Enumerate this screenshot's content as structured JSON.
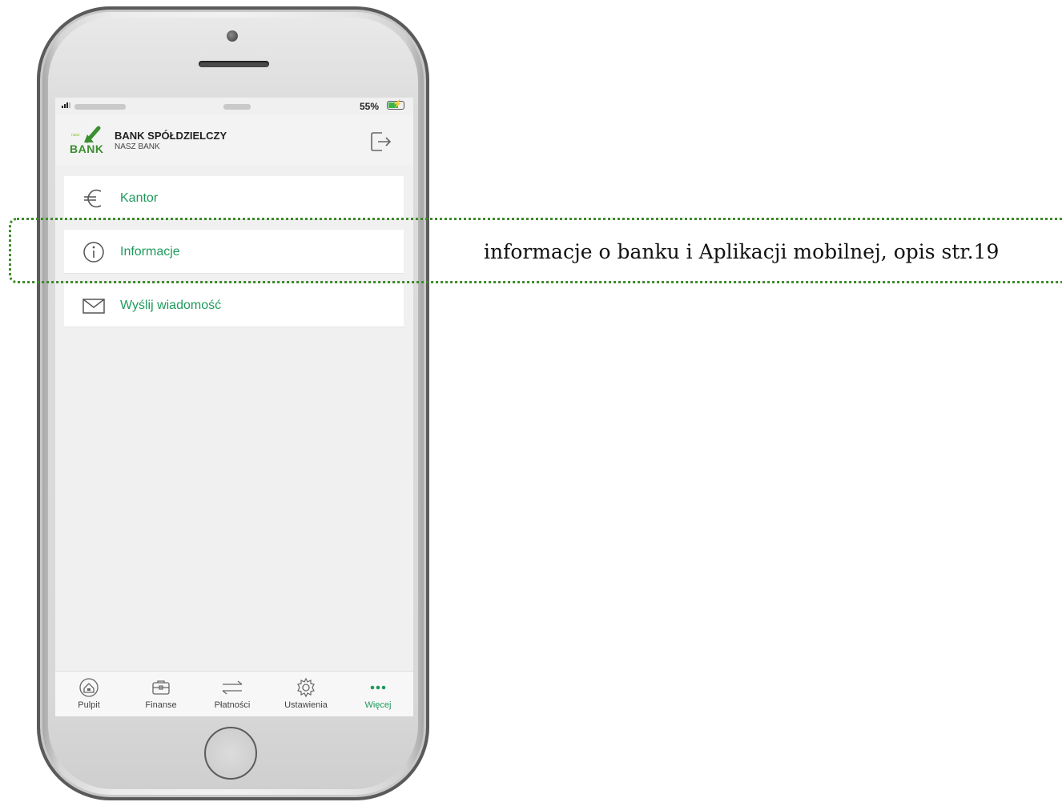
{
  "status_bar": {
    "battery": "55%"
  },
  "header": {
    "logo_small": "nasz",
    "logo_text": "BANK",
    "bank_name": "BANK SPÓŁDZIELCZY",
    "bank_subtitle": "NASZ BANK",
    "logout_icon": "logout-icon"
  },
  "menu": {
    "items": [
      {
        "label": "Kantor",
        "icon": "euro-icon"
      },
      {
        "label": "Informacje",
        "icon": "info-icon"
      },
      {
        "label": "Wyślij wiadomość",
        "icon": "envelope-icon"
      }
    ]
  },
  "tabbar": {
    "tabs": [
      {
        "label": "Pulpit",
        "icon": "home-icon"
      },
      {
        "label": "Finanse",
        "icon": "wallet-icon"
      },
      {
        "label": "Płatności",
        "icon": "transfer-icon"
      },
      {
        "label": "Ustawienia",
        "icon": "gear-icon"
      },
      {
        "label": "Więcej",
        "icon": "more-icon",
        "active": true
      }
    ]
  },
  "callout": {
    "text": "informacje o banku i Aplikacji mobilnej, opis  str.19"
  },
  "colors": {
    "accent": "#1e9a5c",
    "callout_border": "#3d8a2a"
  }
}
